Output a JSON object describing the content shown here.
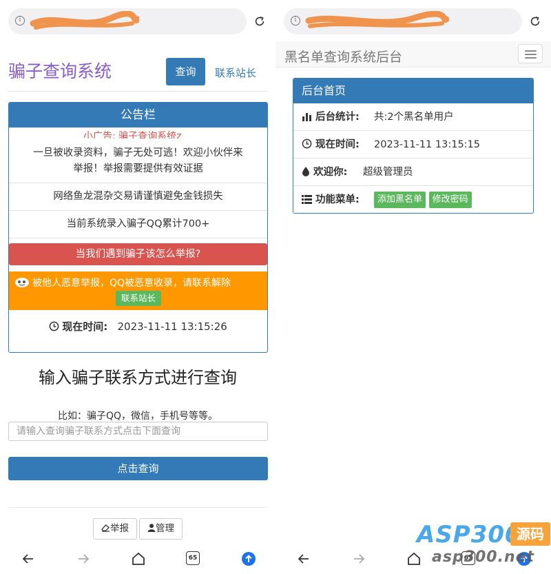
{
  "left": {
    "site_title": "骗子查询系统",
    "query_button": "查询",
    "contact_link": "联系站长",
    "notice": {
      "title": "公告栏",
      "marquee": "小广告: 骗子查询系统z",
      "item1_line1": "一旦被收录资料，骗子无处可逃！欢迎小伙伴来",
      "item1_line2": "举报！举报需要提供有效证据",
      "item2": "网络鱼龙混杂交易请谨慎避免金钱损失",
      "item3": "当前系统录入骗子QQ累计700+",
      "report_bar": "当我们遇到骗子该怎么举报?",
      "appeal_text": "被他人恶意举报，QQ被恶意收录，请联系解除",
      "appeal_button": "联系站长",
      "time_label": "现在时间:",
      "time_value": "2023-11-11 13:15:26"
    },
    "query": {
      "title": "输入骗子联系方式进行查询",
      "hint": "比如：骗子QQ，微信，手机号等等。",
      "placeholder": "请输入查询骗子联系方式点击下面查询",
      "search_button": "点击查询"
    },
    "footer": {
      "report_button": "举报",
      "admin_button": "管理"
    },
    "tab_count": "65"
  },
  "right": {
    "brand": "黑名单查询系统后台",
    "panel_title": "后台首页",
    "stats_label": "后台统计:",
    "stats_value": "共:2个黑名单用户",
    "time_label": "现在时间:",
    "time_value": "2023-11-11 13:15:15",
    "welcome_label": "欢迎你:",
    "welcome_value": "超级管理员",
    "menu_label": "功能菜单:",
    "menu_add": "添加黑名单",
    "menu_password": "修改密码",
    "tab_count": "65"
  },
  "watermark": {
    "brand": "ASP300",
    "badge": "源码",
    "url": "asp300.net"
  },
  "colors": {
    "primary": "#337ab7",
    "danger": "#d9534f",
    "success": "#5cb85c",
    "warning": "#ff9800",
    "title_purple": "#8a5cc7"
  }
}
